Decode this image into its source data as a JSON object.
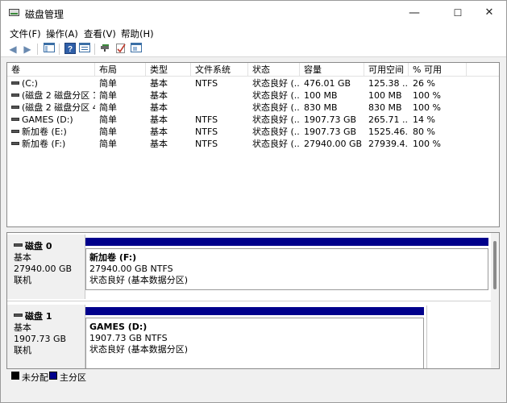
{
  "window": {
    "title": "磁盘管理",
    "minimize": "—",
    "maximize": "☐",
    "close": "✕"
  },
  "menu": [
    "文件(F)",
    "操作(A)",
    "查看(V)",
    "帮助(H)"
  ],
  "toolbar": {
    "icons": [
      "back-arrow-icon",
      "forward-arrow-icon",
      "show-hide-tree-icon",
      "help-icon",
      "properties-icon",
      "connect-icon",
      "check-icon",
      "console-icon"
    ]
  },
  "columns": [
    "卷",
    "布局",
    "类型",
    "文件系统",
    "状态",
    "容量",
    "可用空间",
    "% 可用"
  ],
  "volumes": [
    [
      "(C:)",
      "简单",
      "基本",
      "NTFS",
      "状态良好 (...",
      "476.01 GB",
      "125.38 ...",
      "26 %"
    ],
    [
      "(磁盘 2 磁盘分区 1)",
      "简单",
      "基本",
      "",
      "状态良好 (...",
      "100 MB",
      "100 MB",
      "100 %"
    ],
    [
      "(磁盘 2 磁盘分区 4)",
      "简单",
      "基本",
      "",
      "状态良好 (...",
      "830 MB",
      "830 MB",
      "100 %"
    ],
    [
      "GAMES (D:)",
      "简单",
      "基本",
      "NTFS",
      "状态良好 (...",
      "1907.73 GB",
      "265.71 ...",
      "14 %"
    ],
    [
      "新加卷 (E:)",
      "简单",
      "基本",
      "NTFS",
      "状态良好 (...",
      "1907.73 GB",
      "1525.46...",
      "80 %"
    ],
    [
      "新加卷 (F:)",
      "简单",
      "基本",
      "NTFS",
      "状态良好 (...",
      "27940.00 GB",
      "27939.4...",
      "100 %"
    ]
  ],
  "disks": [
    {
      "name": "磁盘 0",
      "type": "基本",
      "size": "27940.00 GB",
      "state": "联机",
      "partition": {
        "title": "新加卷 (F:)",
        "size_fs": "27940.00 GB NTFS",
        "status": "状态良好 (基本数据分区)"
      }
    },
    {
      "name": "磁盘 1",
      "type": "基本",
      "size": "1907.73 GB",
      "state": "联机",
      "partition": {
        "title": "GAMES (D:)",
        "size_fs": "1907.73 GB NTFS",
        "status": "状态良好 (基本数据分区)"
      }
    }
  ],
  "legend": [
    {
      "label": "未分配",
      "color": "#000000"
    },
    {
      "label": "主分区",
      "color": "#00008b"
    }
  ],
  "colors": {
    "primary_partition": "#00008b",
    "unallocated": "#000000"
  }
}
